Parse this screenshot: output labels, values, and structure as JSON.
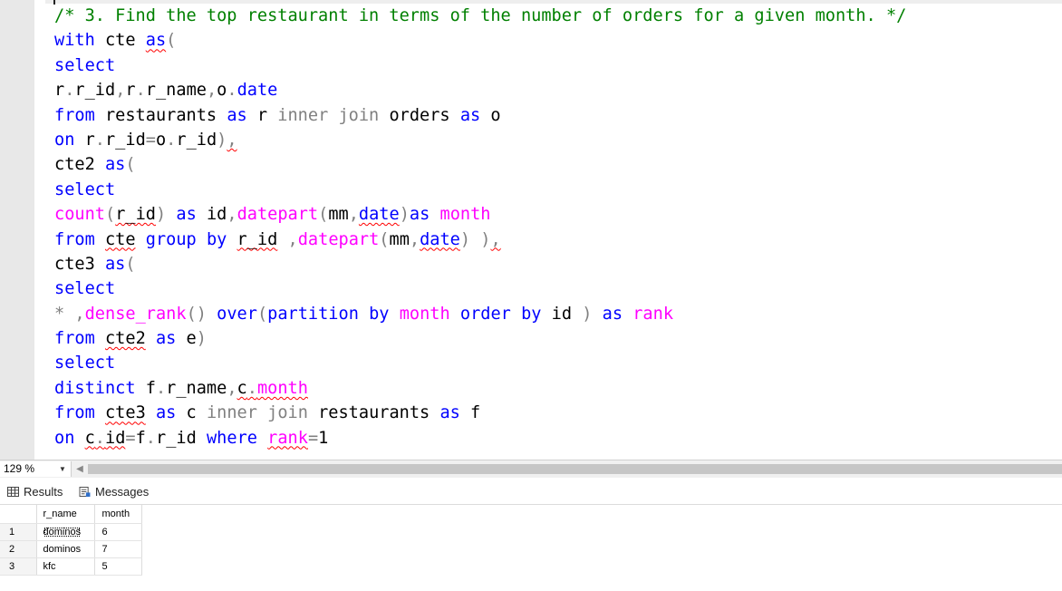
{
  "editor": {
    "lines": [
      [
        {
          "t": "/* 3. Find the top restaurant in terms of the number of orders for a given month. */",
          "c": "cm"
        }
      ],
      [
        {
          "t": "with",
          "c": "kw"
        },
        {
          "t": " cte "
        },
        {
          "t": "as",
          "c": "kw",
          "sq": true
        },
        {
          "t": "(",
          "c": "op"
        }
      ],
      [
        {
          "t": "select",
          "c": "kw"
        }
      ],
      [
        {
          "t": "r"
        },
        {
          "t": ".",
          "c": "op"
        },
        {
          "t": "r_id"
        },
        {
          "t": ",",
          "c": "op"
        },
        {
          "t": "r"
        },
        {
          "t": ".",
          "c": "op"
        },
        {
          "t": "r_name"
        },
        {
          "t": ",",
          "c": "op"
        },
        {
          "t": "o"
        },
        {
          "t": ".",
          "c": "op"
        },
        {
          "t": "date",
          "c": "kw"
        }
      ],
      [
        {
          "t": "from",
          "c": "kw"
        },
        {
          "t": " restaurants "
        },
        {
          "t": "as",
          "c": "kw"
        },
        {
          "t": " r "
        },
        {
          "t": "inner join",
          "c": "op"
        },
        {
          "t": " orders "
        },
        {
          "t": "as",
          "c": "kw"
        },
        {
          "t": " o"
        }
      ],
      [
        {
          "t": "on",
          "c": "kw"
        },
        {
          "t": " r"
        },
        {
          "t": ".",
          "c": "op"
        },
        {
          "t": "r_id"
        },
        {
          "t": "=",
          "c": "op"
        },
        {
          "t": "o"
        },
        {
          "t": ".",
          "c": "op"
        },
        {
          "t": "r_id"
        },
        {
          "t": ")",
          "c": "op"
        },
        {
          "t": ",",
          "c": "op",
          "sq": true
        }
      ],
      [
        {
          "t": "cte2 "
        },
        {
          "t": "as",
          "c": "kw"
        },
        {
          "t": "(",
          "c": "op"
        }
      ],
      [
        {
          "t": "select",
          "c": "kw"
        }
      ],
      [
        {
          "t": "count",
          "c": "fn"
        },
        {
          "t": "(",
          "c": "op"
        },
        {
          "t": "r_id",
          "sq": true
        },
        {
          "t": ")",
          "c": "op"
        },
        {
          "t": " "
        },
        {
          "t": "as",
          "c": "kw"
        },
        {
          "t": " id"
        },
        {
          "t": ",",
          "c": "op"
        },
        {
          "t": "datepart",
          "c": "fn"
        },
        {
          "t": "(",
          "c": "op"
        },
        {
          "t": "mm"
        },
        {
          "t": ",",
          "c": "op"
        },
        {
          "t": "date",
          "c": "kw",
          "sq": true
        },
        {
          "t": ")",
          "c": "op"
        },
        {
          "t": "as",
          "c": "kw"
        },
        {
          "t": " "
        },
        {
          "t": "month",
          "c": "fn"
        }
      ],
      [
        {
          "t": "from",
          "c": "kw"
        },
        {
          "t": " "
        },
        {
          "t": "cte",
          "sq": true
        },
        {
          "t": " "
        },
        {
          "t": "group by",
          "c": "kw"
        },
        {
          "t": " "
        },
        {
          "t": "r_id",
          "sq": true
        },
        {
          "t": " "
        },
        {
          "t": ",",
          "c": "op"
        },
        {
          "t": "datepart",
          "c": "fn"
        },
        {
          "t": "(",
          "c": "op"
        },
        {
          "t": "mm"
        },
        {
          "t": ",",
          "c": "op"
        },
        {
          "t": "date",
          "c": "kw",
          "sq": true
        },
        {
          "t": ")",
          "c": "op"
        },
        {
          "t": " "
        },
        {
          "t": ")",
          "c": "op"
        },
        {
          "t": ",",
          "c": "op",
          "sq": true
        }
      ],
      [
        {
          "t": "cte3 "
        },
        {
          "t": "as",
          "c": "kw"
        },
        {
          "t": "(",
          "c": "op"
        }
      ],
      [
        {
          "t": "select",
          "c": "kw"
        }
      ],
      [
        {
          "t": "*",
          "c": "op"
        },
        {
          "t": " "
        },
        {
          "t": ",",
          "c": "op"
        },
        {
          "t": "dense_rank",
          "c": "fn"
        },
        {
          "t": "()",
          "c": "op"
        },
        {
          "t": " "
        },
        {
          "t": "over",
          "c": "kw"
        },
        {
          "t": "(",
          "c": "op"
        },
        {
          "t": "partition",
          "c": "kw"
        },
        {
          "t": " "
        },
        {
          "t": "by",
          "c": "kw"
        },
        {
          "t": " "
        },
        {
          "t": "month",
          "c": "fn"
        },
        {
          "t": " "
        },
        {
          "t": "order",
          "c": "kw"
        },
        {
          "t": " "
        },
        {
          "t": "by",
          "c": "kw"
        },
        {
          "t": " id "
        },
        {
          "t": ")",
          "c": "op"
        },
        {
          "t": " "
        },
        {
          "t": "as",
          "c": "kw"
        },
        {
          "t": " "
        },
        {
          "t": "rank",
          "c": "fn"
        }
      ],
      [
        {
          "t": "from",
          "c": "kw"
        },
        {
          "t": " "
        },
        {
          "t": "cte2",
          "sq": true
        },
        {
          "t": " "
        },
        {
          "t": "as",
          "c": "kw"
        },
        {
          "t": " e"
        },
        {
          "t": ")",
          "c": "op"
        }
      ],
      [
        {
          "t": "select",
          "c": "kw"
        }
      ],
      [
        {
          "t": "distinct",
          "c": "kw"
        },
        {
          "t": " f"
        },
        {
          "t": ".",
          "c": "op"
        },
        {
          "t": "r_name"
        },
        {
          "t": ",",
          "c": "op"
        },
        {
          "t": "c",
          "sq": true
        },
        {
          "t": ".",
          "c": "op",
          "sq": true
        },
        {
          "t": "month",
          "c": "fn",
          "sq": true
        }
      ],
      [
        {
          "t": "from",
          "c": "kw"
        },
        {
          "t": " "
        },
        {
          "t": "cte3",
          "sq": true
        },
        {
          "t": " "
        },
        {
          "t": "as",
          "c": "kw"
        },
        {
          "t": " c "
        },
        {
          "t": "inner join",
          "c": "op"
        },
        {
          "t": " restaurants "
        },
        {
          "t": "as",
          "c": "kw"
        },
        {
          "t": " f"
        }
      ],
      [
        {
          "t": "on",
          "c": "kw"
        },
        {
          "t": " "
        },
        {
          "t": "c",
          "sq": true
        },
        {
          "t": ".",
          "c": "op",
          "sq": true
        },
        {
          "t": "id",
          "sq": true
        },
        {
          "t": "=",
          "c": "op"
        },
        {
          "t": "f"
        },
        {
          "t": ".",
          "c": "op"
        },
        {
          "t": "r_id"
        },
        {
          "t": " "
        },
        {
          "t": "where",
          "c": "kw"
        },
        {
          "t": " "
        },
        {
          "t": "rank",
          "c": "fn",
          "sq": true
        },
        {
          "t": "=",
          "c": "op"
        },
        {
          "t": "1"
        }
      ]
    ]
  },
  "zoom": {
    "value": "129 %",
    "dropdown_icon": "chevron-down-icon",
    "scroll_left_icon": "arrow-left-icon"
  },
  "tabs": [
    {
      "label": "Results",
      "icon": "grid-icon",
      "active": true
    },
    {
      "label": "Messages",
      "icon": "messages-icon",
      "active": false
    }
  ],
  "results": {
    "columns": [
      "r_name",
      "month"
    ],
    "rows": [
      {
        "num": "1",
        "r_name": "dominos",
        "month": "6"
      },
      {
        "num": "2",
        "r_name": "dominos",
        "month": "7"
      },
      {
        "num": "3",
        "r_name": "kfc",
        "month": "5"
      }
    ]
  }
}
